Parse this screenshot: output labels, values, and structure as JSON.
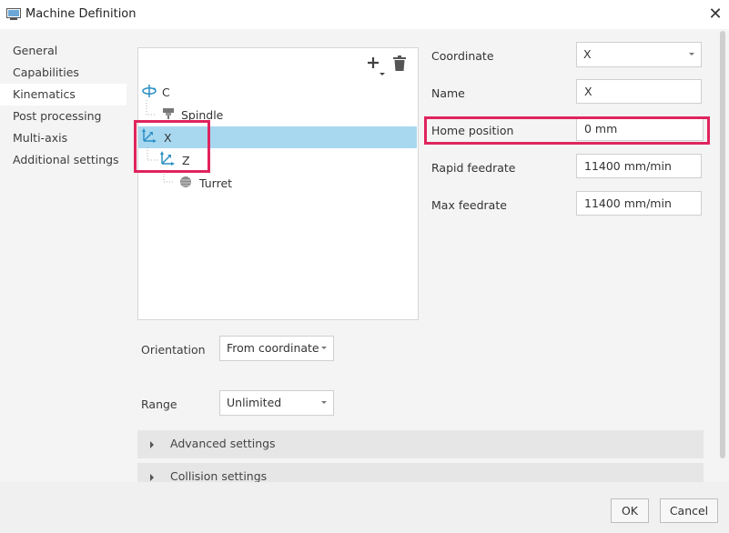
{
  "window": {
    "title": "Machine Definition"
  },
  "nav": {
    "items": [
      {
        "label": "General"
      },
      {
        "label": "Capabilities"
      },
      {
        "label": "Kinematics"
      },
      {
        "label": "Post processing"
      },
      {
        "label": "Multi-axis"
      },
      {
        "label": "Additional settings"
      }
    ],
    "active_index": 2
  },
  "tree": {
    "nodes": [
      {
        "label": "C",
        "icon": "rotary-axis-icon"
      },
      {
        "label": "Spindle",
        "icon": "spindle-icon"
      },
      {
        "label": "X",
        "icon": "linear-axis-icon",
        "selected": true
      },
      {
        "label": "Z",
        "icon": "linear-axis-icon"
      },
      {
        "label": "Turret",
        "icon": "turret-icon"
      }
    ]
  },
  "properties": {
    "coordinate": {
      "label": "Coordinate",
      "value": "X"
    },
    "name": {
      "label": "Name",
      "value": "X"
    },
    "home_position": {
      "label": "Home position",
      "value": "0 mm"
    },
    "rapid_feedrate": {
      "label": "Rapid feedrate",
      "value": "11400 mm/min"
    },
    "max_feedrate": {
      "label": "Max feedrate",
      "value": "11400 mm/min"
    }
  },
  "orientation": {
    "label": "Orientation",
    "value": "From coordinate"
  },
  "range": {
    "label": "Range",
    "value": "Unlimited"
  },
  "sections": {
    "advanced": "Advanced settings",
    "collision": "Collision settings"
  },
  "buttons": {
    "ok": "OK",
    "cancel": "Cancel"
  },
  "colors": {
    "selection": "#a8d8f0",
    "highlight": "#e0245e",
    "axis_icon": "#2a8fc4"
  }
}
